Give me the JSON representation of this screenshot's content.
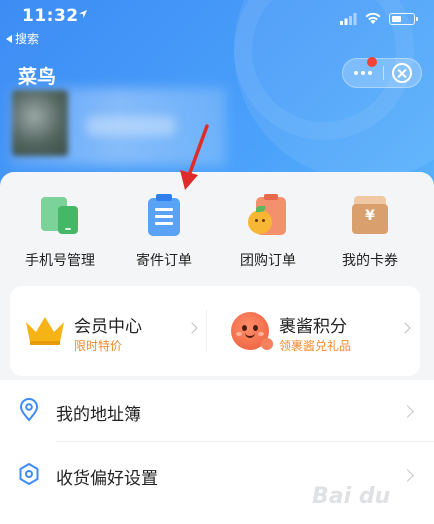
{
  "status_bar": {
    "time": "11:32"
  },
  "nav": {
    "back_label": "搜索",
    "title": "菜鸟"
  },
  "grid": [
    {
      "label": "手机号管理",
      "icon": "phone-manage-icon"
    },
    {
      "label": "寄件订单",
      "icon": "clipboard-order-icon"
    },
    {
      "label": "团购订单",
      "icon": "group-buy-icon"
    },
    {
      "label": "我的卡券",
      "icon": "coupon-icon"
    }
  ],
  "member": {
    "left": {
      "title": "会员中心",
      "subtitle": "限时特价",
      "icon": "crown-icon"
    },
    "right": {
      "title": "裹酱积分",
      "subtitle": "领裹酱兑礼品",
      "icon": "mascot-icon"
    }
  },
  "list": [
    {
      "label": "我的地址簿",
      "icon": "location-pin-icon"
    },
    {
      "label": "收货偏好设置",
      "icon": "hexagon-settings-icon"
    }
  ],
  "colors": {
    "header_blue": "#3d8cf5",
    "accent_orange": "#f08a2c",
    "arrow_red": "#e02b2b"
  },
  "watermark": {
    "text": "Bai du"
  }
}
